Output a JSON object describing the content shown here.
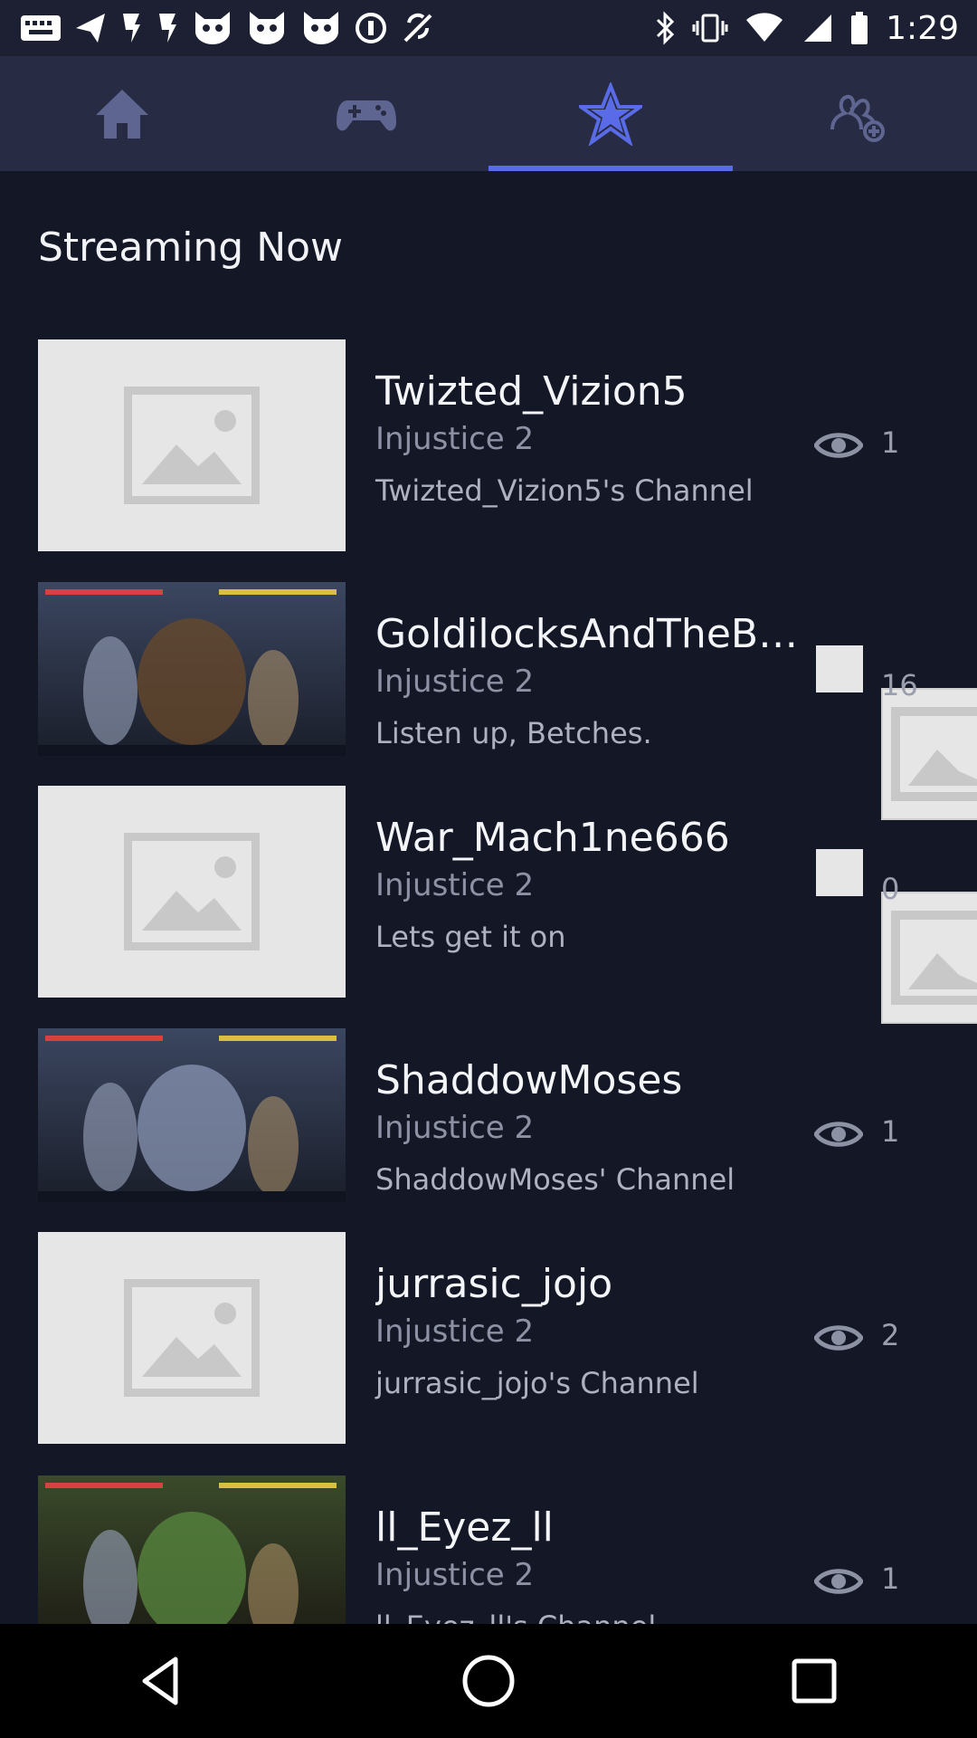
{
  "status_bar": {
    "time": "1:29",
    "left_icons": [
      "message-icon",
      "send-icon",
      "notification-icon",
      "notification-icon",
      "cat-icon",
      "cat-icon",
      "cat-icon",
      "info-icon",
      "location-off-icon"
    ],
    "right_icons": [
      "bluetooth-icon",
      "vibrate-icon",
      "wifi-icon",
      "signal-icon",
      "battery-icon"
    ]
  },
  "tabs": [
    {
      "name": "home",
      "icon": "home-icon",
      "active": false
    },
    {
      "name": "games",
      "icon": "gamepad-icon",
      "active": false
    },
    {
      "name": "featured",
      "icon": "star-icon",
      "active": true
    },
    {
      "name": "social",
      "icon": "add-friend-icon",
      "active": false
    }
  ],
  "colors": {
    "background": "#141826",
    "tabbar": "#272c44",
    "accent": "#5a6be8"
  },
  "section_title": "Streaming Now",
  "streams": [
    {
      "name": "Twizted_Vizion5",
      "game": "Injustice 2",
      "channel": "Twizted_Vizion5's Channel",
      "viewers": "1",
      "thumb": "placeholder",
      "viewer_icon": "eye-icon"
    },
    {
      "name": "GoldilocksAndTheBe...",
      "game": "Injustice 2",
      "channel": "Listen up, Betches.",
      "viewers": "16",
      "thumb": "photo",
      "viewer_icon": "broken-image"
    },
    {
      "name": "War_Mach1ne666",
      "game": "Injustice 2",
      "channel": "Lets get it on",
      "viewers": "0",
      "thumb": "placeholder",
      "viewer_icon": "broken-image"
    },
    {
      "name": "ShaddowMoses",
      "game": "Injustice 2",
      "channel": "ShaddowMoses' Channel",
      "viewers": "1",
      "thumb": "photo",
      "viewer_icon": "eye-icon"
    },
    {
      "name": "jurrasic_jojo",
      "game": "Injustice 2",
      "channel": "jurrasic_jojo's Channel",
      "viewers": "2",
      "thumb": "placeholder",
      "viewer_icon": "eye-icon"
    },
    {
      "name": "ll_Eyez_ll",
      "game": "Injustice 2",
      "channel": "ll_Eyez_ll's Channel",
      "viewers": "1",
      "thumb": "photo",
      "viewer_icon": "eye-icon"
    }
  ],
  "nav_bar": [
    "back-icon",
    "home-circle-icon",
    "recents-icon"
  ]
}
